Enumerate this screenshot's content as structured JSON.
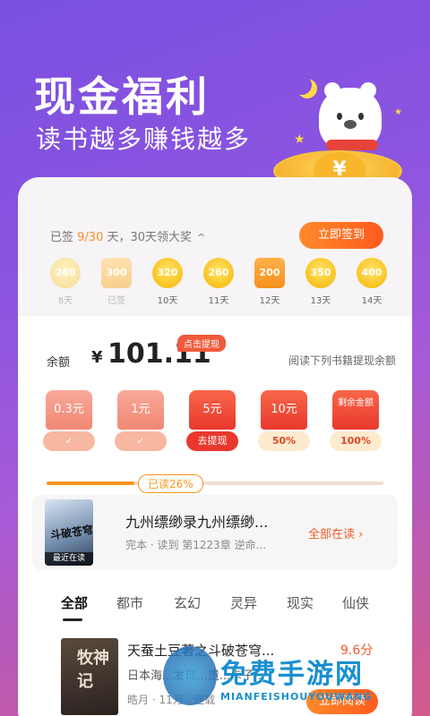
{
  "hero": {
    "title": "现金福利",
    "subtitle": "读书越多赚钱越多",
    "coin_symbol": "¥"
  },
  "signin": {
    "prefix": "已签 ",
    "progress": "9/30",
    "suffix": " 天，30天领大奖",
    "caret": "^",
    "button": "立即签到",
    "days": [
      {
        "amount": "280",
        "label": "8天",
        "state": "signed-faded"
      },
      {
        "amount": "300",
        "label": "已签",
        "state": "box-faded"
      },
      {
        "amount": "320",
        "label": "10天",
        "state": "coin"
      },
      {
        "amount": "260",
        "label": "11天",
        "state": "coin"
      },
      {
        "amount": "200",
        "label": "12天",
        "state": "box"
      },
      {
        "amount": "350",
        "label": "13天",
        "state": "coin"
      },
      {
        "amount": "400",
        "label": "14天",
        "state": "coin"
      }
    ]
  },
  "balance": {
    "label": "余额",
    "currency": "¥",
    "value": "101.11",
    "tag": "点击提现",
    "hint": "阅读下列书籍提现余额",
    "envelopes": [
      {
        "amount": "0.3元",
        "action": "✓",
        "style": "pale"
      },
      {
        "amount": "1元",
        "action": "✓",
        "style": "pale"
      },
      {
        "amount": "5元",
        "action": "去提现",
        "style": "red"
      },
      {
        "amount": "10元",
        "action": "50%",
        "style": "lite"
      },
      {
        "amount": "剩余金额",
        "action": "100%",
        "style": "lite"
      }
    ],
    "progress_label": "已读26%",
    "progress_percent": 26
  },
  "recent": {
    "cover_title": "斗破苍穹",
    "cover_tag": "最近在读",
    "title": "九州缥缈录九州缥缈...",
    "meta": "完本 · 读到  第1223章 逆命...",
    "link": "全部在读 ›"
  },
  "tabs": [
    "全部",
    "都市",
    "玄幻",
    "灵异",
    "现实",
    "仙侠"
  ],
  "book": {
    "cover_text": "牧神记",
    "title": "天蚕土豆著之斗破苍穹...",
    "score": "9.6分",
    "desc": "日本海...发现...遗...卡子...",
    "meta": "晧月 · 11万 · 连载",
    "read_button": "立即阅读"
  },
  "watermark": {
    "text": "免费手游网",
    "sub": "MIANFEISHOUYOUWANG"
  }
}
